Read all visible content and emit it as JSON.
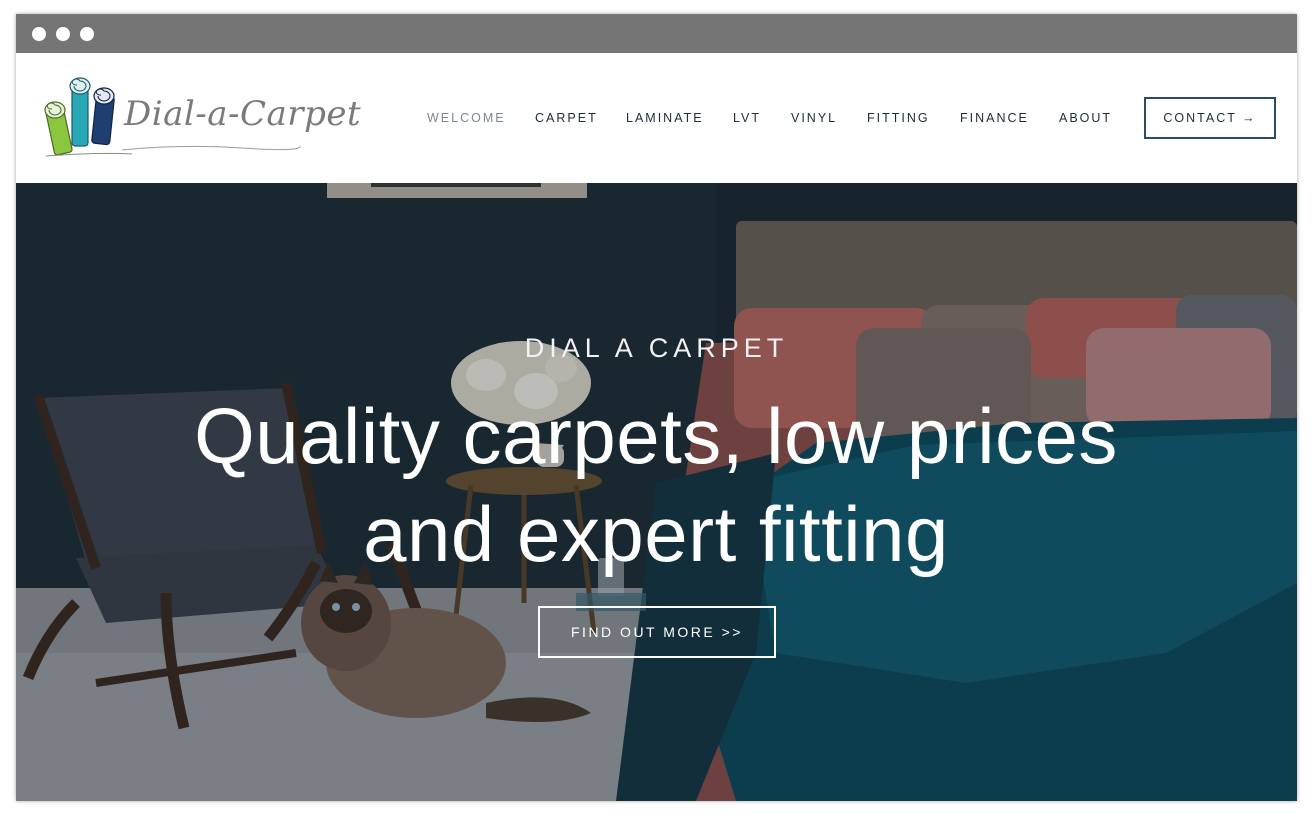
{
  "colors": {
    "chrome": "#757575",
    "nav_text": "#1d2b3a",
    "nav_active": "#7b8794",
    "contact_border": "#2f4b60",
    "hero_wall": "#1b2a33",
    "logo_green": "#8cc63f",
    "logo_teal": "#27a8b4",
    "logo_navy": "#1f3f73"
  },
  "logo": {
    "text": "Dial-a-Carpet",
    "icon": "carpet-rolls-icon"
  },
  "nav": {
    "items": [
      {
        "label": "WELCOME",
        "active": true
      },
      {
        "label": "CARPET",
        "active": false
      },
      {
        "label": "LAMINATE",
        "active": false
      },
      {
        "label": "LVT",
        "active": false
      },
      {
        "label": "VINYL",
        "active": false
      },
      {
        "label": "FITTING",
        "active": false
      },
      {
        "label": "FINANCE",
        "active": false
      },
      {
        "label": "ABOUT",
        "active": false
      }
    ],
    "contact_label": "CONTACT →"
  },
  "hero": {
    "kicker": "DIAL A CARPET",
    "title": "Quality carpets, low prices and expert fitting",
    "cta_label": "FIND OUT MORE >>"
  }
}
